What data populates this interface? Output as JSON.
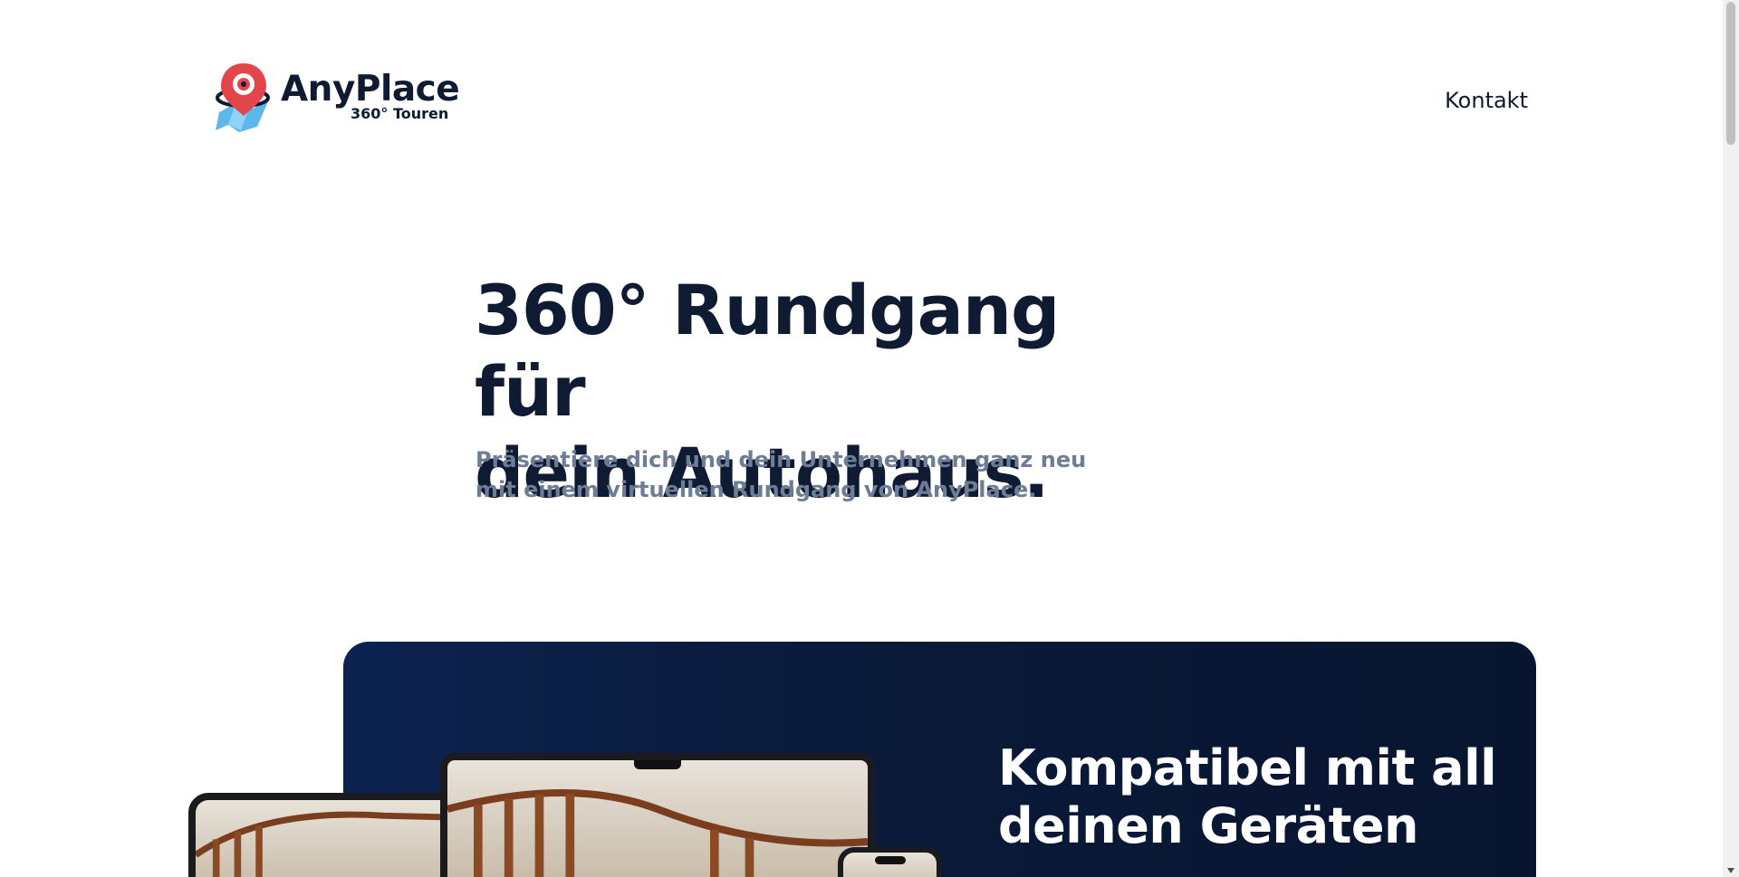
{
  "brand": {
    "name": "AnyPlace",
    "tagline": "360° Touren"
  },
  "nav": {
    "contact": "Kontakt"
  },
  "hero": {
    "title_line1": "360° Rundgang für",
    "title_line2": "dein Autohaus.",
    "subtitle_line1": "Präsentiere dich und dein Unternehmen ganz neu",
    "subtitle_line2": "mit einem virtuellen Rundgang von AnyPlace."
  },
  "devices_section": {
    "title_line1": "Kompatibel mit all",
    "title_line2": "deinen Geräten"
  },
  "colors": {
    "primary": "#0f1a33",
    "muted_text": "#6e7d96",
    "card_bg": "#0a1a3a",
    "logo_pin": "#e2464a",
    "logo_map": "#5cb8e8"
  },
  "icons": {
    "logo": "map-pin-logo-icon",
    "scroll_down": "chevron-down-icon"
  }
}
